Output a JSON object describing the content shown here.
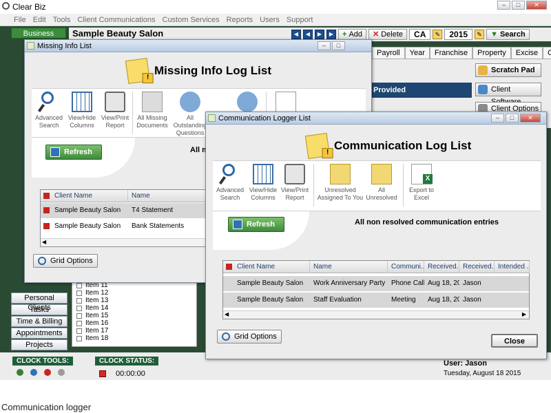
{
  "app": {
    "title": "Clear Biz",
    "menu": [
      "File",
      "Edit",
      "Tools",
      "Client Communications",
      "Custom Services",
      "Reports",
      "Users",
      "Support"
    ],
    "business_tab": "Business Clients",
    "client_name": "Sample Beauty Salon",
    "toolbar": {
      "add": "Add",
      "delete": "Delete",
      "province": "CA",
      "year": "2015",
      "search": "Search"
    },
    "tabs": [
      "Payroll",
      "Year End",
      "Franchise",
      "Property",
      "Excise",
      "Ot"
    ],
    "provided_label": "Provided",
    "right_buttons": [
      "Scratch Pad",
      "Client Software",
      "Client Options"
    ],
    "side_nav": [
      "Personal Clients",
      "Tasks",
      "Time & Billing",
      "Appointments",
      "Projects"
    ],
    "items": [
      "Item 11",
      "Item 12",
      "Item 13",
      "Item 14",
      "Item 15",
      "Item 16",
      "Item 17",
      "Item 18"
    ],
    "clock_tools_label": "CLOCK TOOLS:",
    "clock_status_label": "CLOCK STATUS:",
    "clock_time": "00:00:00",
    "user_label": "User: Jason",
    "date_label": "Tuesday, August 18 2015"
  },
  "missing_window": {
    "title": "Missing Info List",
    "header": "Missing Info Log List",
    "ribbon": [
      "Advanced Search",
      "View/Hide Columns",
      "View/Print Report",
      "All Missing Documents",
      "All Outstanding Questions"
    ],
    "refresh": "Refresh List",
    "filter_text": "All m",
    "columns": [
      "Client Name",
      "Name"
    ],
    "rows": [
      [
        "Sample Beauty Salon",
        "T4 Statement"
      ],
      [
        "Sample Beauty Salon",
        "Bank Statements"
      ]
    ],
    "grid_options": "Grid Options"
  },
  "comm_window": {
    "title": "Communication Logger List",
    "header": "Communication Log List",
    "ribbon": [
      "Advanced Search",
      "View/Hide Columns",
      "View/Print Report",
      "Unresolved Assigned To You",
      "All Unresolved",
      "Export to Excel"
    ],
    "refresh": "Refresh List",
    "filter_text": "All non resolved communication entries",
    "columns": [
      "Client Name",
      "Name",
      "Communi...",
      "Received...",
      "Received...",
      "Intended ..."
    ],
    "rows": [
      [
        "Sample Beauty Salon",
        "Work Anniversary Party",
        "Phone Call",
        "Aug 18, 20...",
        "Jason",
        ""
      ],
      [
        "Sample Beauty Salon",
        "Staff Evaluation",
        "Meeting",
        "Aug 18, 20...",
        "Jason",
        ""
      ]
    ],
    "grid_options": "Grid Options",
    "close": "Close"
  },
  "caption": "Communication logger"
}
